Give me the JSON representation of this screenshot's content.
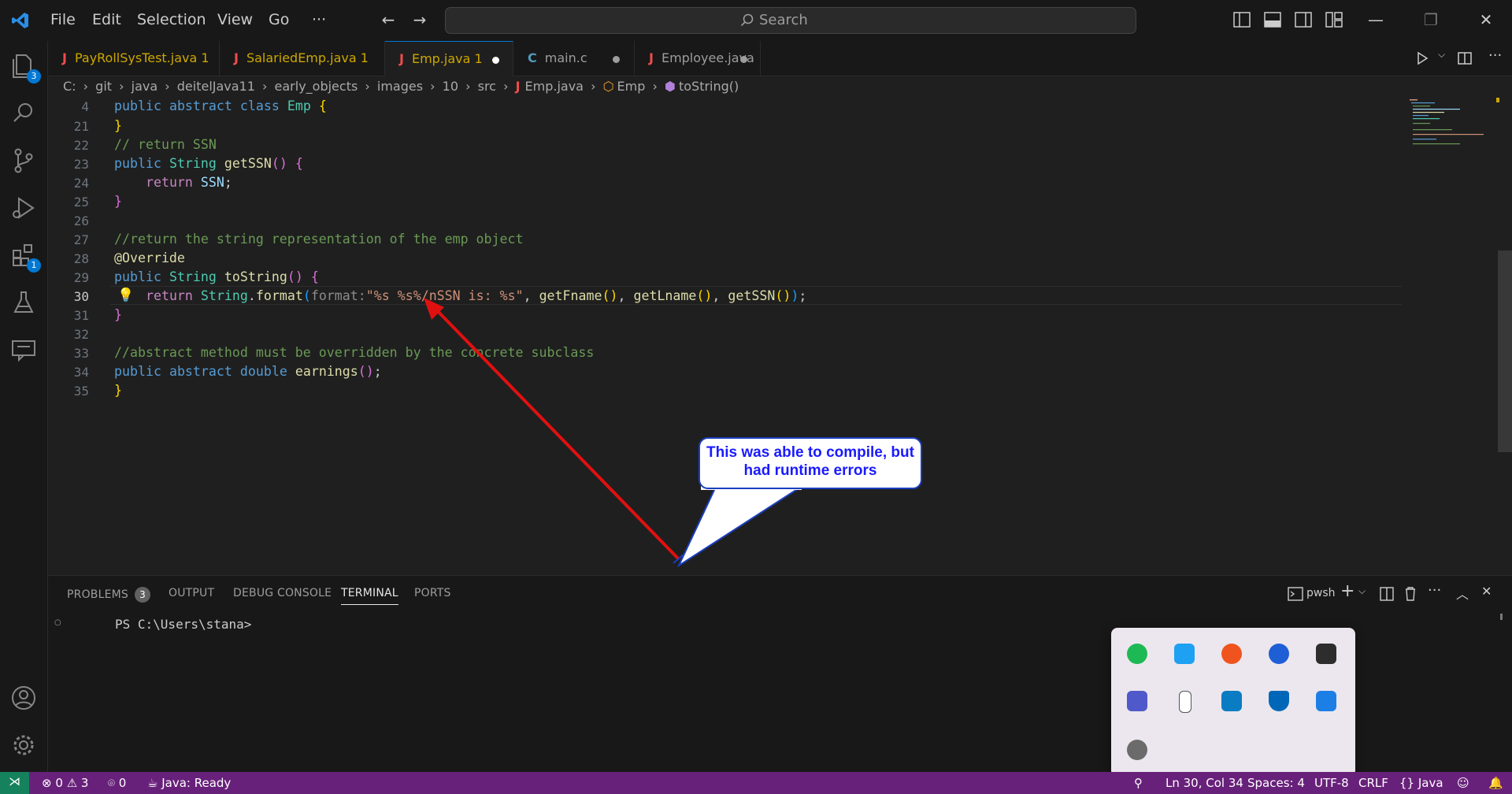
{
  "menu": {
    "file": "File",
    "edit": "Edit",
    "selection": "Selection",
    "view": "View",
    "go": "Go",
    "more": "···"
  },
  "search": {
    "label": "Search"
  },
  "activity": {
    "explorer_badge": "3",
    "extensions_badge": "1"
  },
  "tabs": [
    {
      "label": "PayRollSysTest.java 1",
      "icon": "J"
    },
    {
      "label": "SalariedEmp.java 1",
      "icon": "J"
    },
    {
      "label": "Emp.java 1",
      "icon": "J"
    },
    {
      "label": "main.c",
      "icon": "C"
    },
    {
      "label": "Employee.java",
      "icon": "J"
    }
  ],
  "breadcrumb": [
    "C:",
    "git",
    "java",
    "deitelJava11",
    "early_objects",
    "images",
    "10",
    "src",
    "Emp.java",
    "Emp",
    "toString()"
  ],
  "editor": {
    "line_numbers": [
      "4",
      "21",
      "22",
      "23",
      "24",
      "25",
      "26",
      "27",
      "28",
      "29",
      "30",
      "31",
      "32",
      "33",
      "34",
      "35"
    ],
    "sticky": {
      "kw1": "public",
      "kw2": "abstract",
      "kw3": "class",
      "cls": "Emp",
      "brace": "{"
    },
    "l21": "}",
    "l22": "// return SSN",
    "l23": {
      "kw": "public",
      "ty": "String",
      "fn": "getSSN",
      "p": "()",
      "b": "{"
    },
    "l24": {
      "kw": "return",
      "v": "SSN",
      "semi": ";"
    },
    "l25": "}",
    "l27": "//return the string representation of the emp object",
    "l28": "@Override",
    "l29": {
      "kw": "public",
      "ty": "String",
      "fn": "toString",
      "p": "()",
      "b": "{"
    },
    "l30": {
      "kw": "return",
      "ty": "String",
      "dot": ".",
      "fn": "format",
      "open": "(",
      "hint": "format:",
      "str": "\"%s %s%/nSSN is: %s\"",
      "rest1": ", ",
      "f1": "getFname",
      "p1": "()",
      "rest2": ", ",
      "f2": "getLname",
      "p2": "()",
      "rest3": ", ",
      "f3": "getSSN",
      "p3": "()",
      "close": ")",
      "semi": ";"
    },
    "l31": "}",
    "l33": "//abstract method must be overridden by the concrete subclass",
    "l34": {
      "kw1": "public",
      "kw2": "abstract",
      "kw3": "double",
      "fn": "earnings",
      "p": "()",
      "semi": ";"
    },
    "l35": "}"
  },
  "callout": {
    "text": "This was able to compile, but had runtime errors"
  },
  "panel": {
    "tabs": {
      "problems": "PROBLEMS",
      "problems_count": "3",
      "output": "OUTPUT",
      "debug": "DEBUG CONSOLE",
      "terminal": "TERMINAL",
      "ports": "PORTS"
    },
    "shell": "pwsh",
    "prompt": "PS C:\\Users\\stana>"
  },
  "status": {
    "errors": "0",
    "warnings": "3",
    "ports": "0",
    "java": "Java: Ready",
    "position": "Ln 30, Col 34",
    "spaces": "Spaces: 4",
    "encoding": "UTF-8",
    "eol": "CRLF",
    "language": "Java"
  },
  "colors": {
    "statusbar": "#68217a",
    "remote": "#16825d",
    "accent": "#0078d4",
    "arrow": "#e01010",
    "callout_border": "#1a3fbf"
  }
}
